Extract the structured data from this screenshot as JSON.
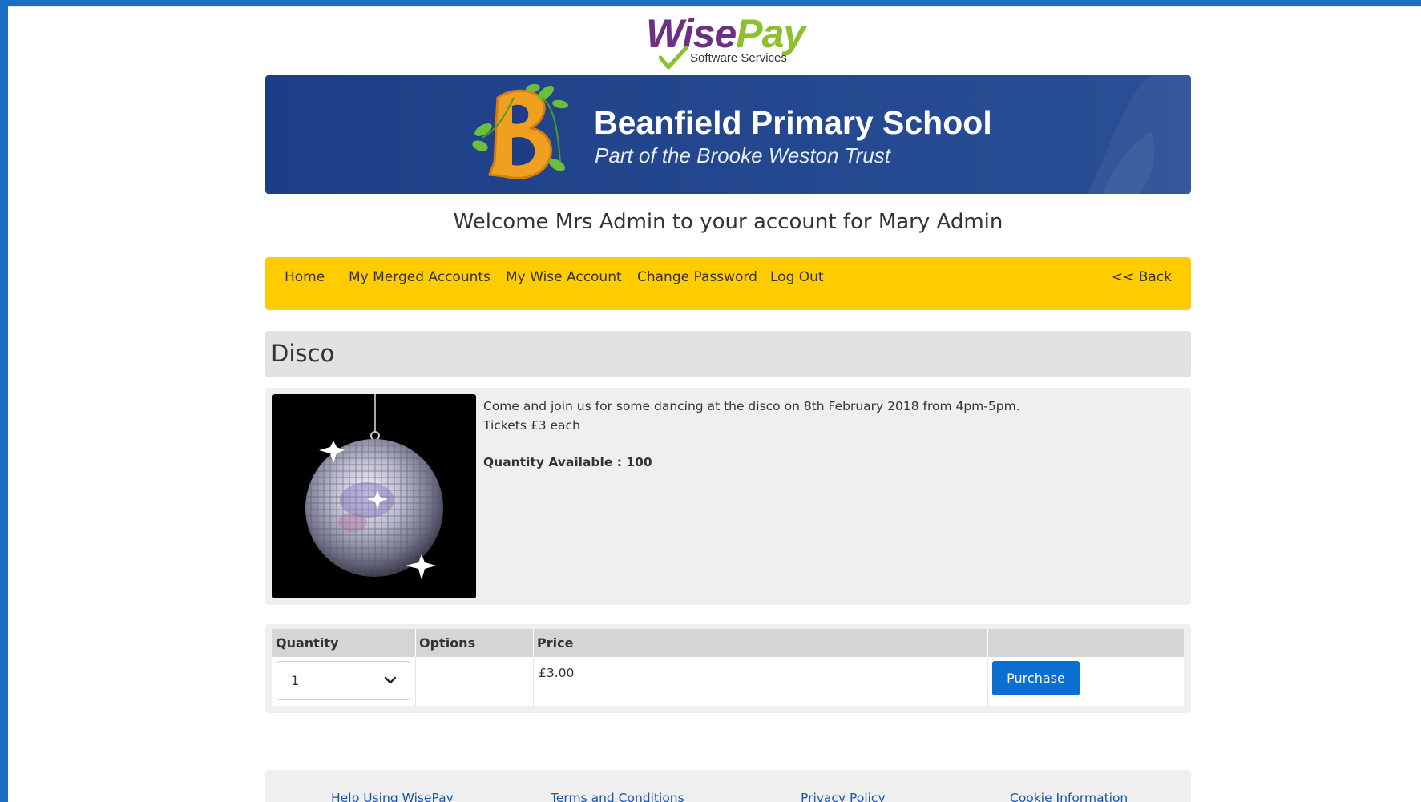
{
  "brand": {
    "logo_part1": "Wise",
    "logo_part2": "Pay",
    "logo_tagline": "Software Services",
    "colors": {
      "primary": "#6b2f83",
      "secondary": "#8dbf2f"
    }
  },
  "school": {
    "name": "Beanfield Primary School",
    "trust": "Part of the Brooke Weston Trust",
    "banner_color": "#1d3e86"
  },
  "welcome": "Welcome Mrs Admin to your account for Mary Admin",
  "nav": {
    "items": [
      {
        "label": "Home"
      },
      {
        "label": "My Merged Accounts"
      },
      {
        "label": "My Wise Account"
      },
      {
        "label": "Change Password"
      },
      {
        "label": "Log Out"
      }
    ],
    "back_label": "<< Back",
    "color": "#ffcc00"
  },
  "page": {
    "title": "Disco"
  },
  "product": {
    "image_icon": "disco-ball",
    "description_line1": "Come and join us for some dancing at the disco on 8th February 2018 from 4pm-5pm.",
    "description_line2": "Tickets £3 each",
    "quantity_available": "Quantity Available : 100"
  },
  "purchase_table": {
    "headers": [
      "Quantity",
      "Options",
      "Price",
      ""
    ],
    "quantity_selected": "1",
    "options": "",
    "price": "£3.00",
    "button_label": "Purchase",
    "button_color": "#0a6fd1"
  },
  "footer": {
    "links": [
      {
        "label": "Help Using WisePay"
      },
      {
        "label": "Terms and Conditions"
      },
      {
        "label": "Privacy Policy"
      },
      {
        "label": "Cookie Information"
      }
    ]
  }
}
